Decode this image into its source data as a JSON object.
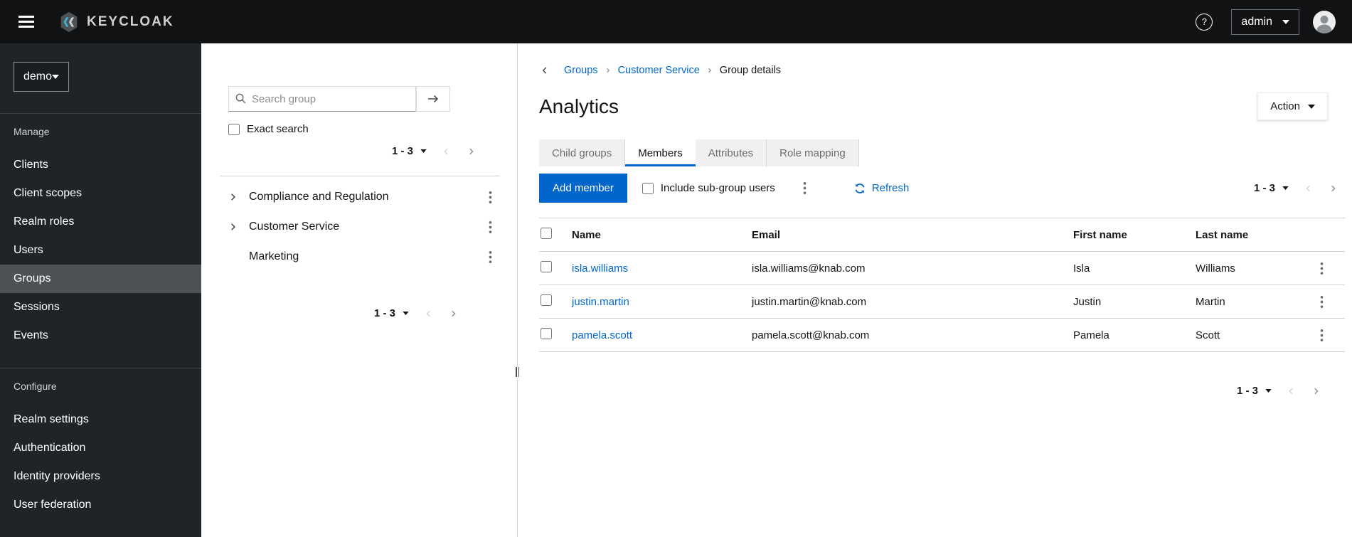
{
  "colors": {
    "accent": "#0066cc",
    "topbar_bg": "#111214",
    "sidebar_bg": "#212427",
    "sidebar_selected_bg": "#4f5255",
    "brand_cyan": "#3db2d2",
    "link": "#0066cc"
  },
  "icons": {
    "help_question": "?"
  },
  "topbar": {
    "brand": "KEYCLOAK",
    "user": "admin"
  },
  "sidebar": {
    "realm": "demo",
    "manage_label": "Manage",
    "manage_items": [
      "Clients",
      "Client scopes",
      "Realm roles",
      "Users",
      "Groups",
      "Sessions",
      "Events"
    ],
    "selected_item": "Groups",
    "configure_label": "Configure",
    "configure_items": [
      "Realm settings",
      "Authentication",
      "Identity providers",
      "User federation"
    ]
  },
  "tree": {
    "search_placeholder": "Search group",
    "exact_search_label": "Exact search",
    "pagination": "1 - 3",
    "groups": [
      "Compliance and Regulation",
      "Customer Service",
      "Marketing"
    ],
    "pagination_bottom": "1 - 3"
  },
  "main": {
    "breadcrumb": {
      "groups": "Groups",
      "parent": "Customer Service",
      "current": "Group details"
    },
    "title": "Analytics",
    "action_label": "Action",
    "tabs": [
      "Child groups",
      "Members",
      "Attributes",
      "Role mapping"
    ],
    "active_tab": "Members",
    "toolbar": {
      "add_member": "Add member",
      "include_subgroups": "Include sub-group users",
      "refresh": "Refresh",
      "pagination": "1 - 3"
    },
    "table": {
      "headers": {
        "name": "Name",
        "email": "Email",
        "first_name": "First name",
        "last_name": "Last name"
      },
      "rows": [
        {
          "username": "isla.williams",
          "email": "isla.williams@knab.com",
          "first_name": "Isla",
          "last_name": "Williams"
        },
        {
          "username": "justin.martin",
          "email": "justin.martin@knab.com",
          "first_name": "Justin",
          "last_name": "Martin"
        },
        {
          "username": "pamela.scott",
          "email": "pamela.scott@knab.com",
          "first_name": "Pamela",
          "last_name": "Scott"
        }
      ]
    },
    "bottom_pagination": "1 - 3"
  }
}
